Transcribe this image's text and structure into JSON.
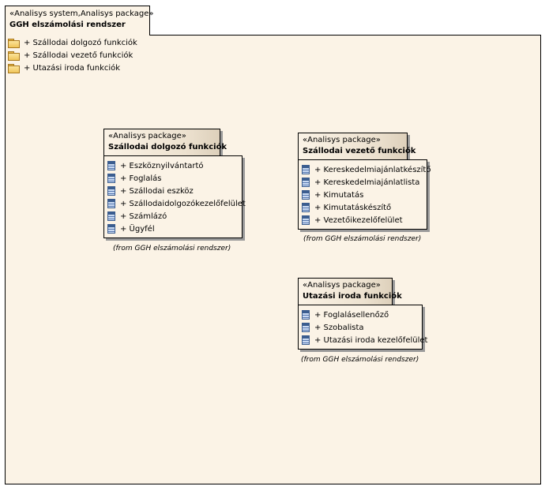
{
  "main_package": {
    "stereotype": "«Analisys system,Analisys package»",
    "name": "GGH elszámolási rendszer",
    "contents": [
      {
        "label": "+ Szállodai dolgozó funkciók",
        "icon": "folder-icon"
      },
      {
        "label": "+ Szállodai vezető funkciók",
        "icon": "folder-icon"
      },
      {
        "label": "+ Utazási iroda funkciók",
        "icon": "folder-icon"
      }
    ]
  },
  "packages": [
    {
      "stereotype": "«Analisys package»",
      "name": "Szállodai dolgozó funkciók",
      "from": "(from GGH elszámolási rendszer)",
      "items": [
        "+ Eszköznyilvántartó",
        "+ Foglalás",
        "+ Szállodai eszköz",
        "+ Szállodaidolgozókezelőfelület",
        "+ Számlázó",
        "+ Ügyfél"
      ]
    },
    {
      "stereotype": "«Analisys package»",
      "name": "Szállodai vezető funkciók",
      "from": "(from GGH elszámolási rendszer)",
      "items": [
        "+ Kereskedelmiajánlatkészítő",
        "+ Kereskedelmiajánlatlista",
        "+ Kimutatás",
        "+ Kimutatáskészítő",
        "+ Vezetőikezelőfelület"
      ]
    },
    {
      "stereotype": "«Analisys package»",
      "name": "Utazási iroda funkciók",
      "from": "(from GGH elszámolási rendszer)",
      "items": [
        "+ Foglaláselle­nőző",
        "+ Szobalista",
        "+ Utazási iroda kezelőfelület"
      ]
    }
  ],
  "colors": {
    "fill": "#fbf3e6",
    "border": "#000000",
    "shadow": "#9a9a9a"
  }
}
